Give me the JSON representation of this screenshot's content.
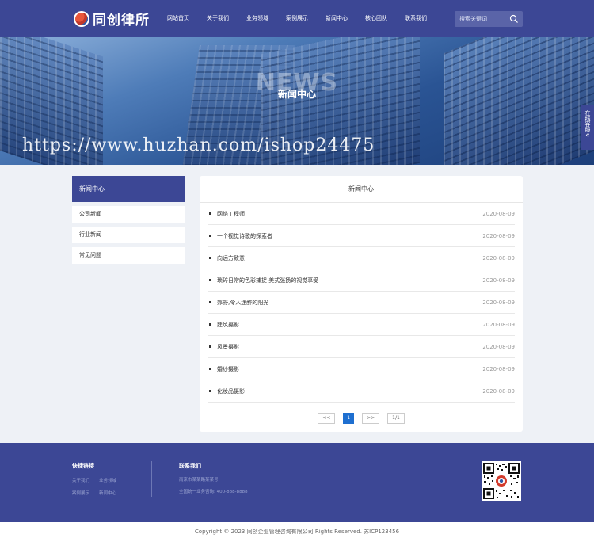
{
  "header": {
    "logo_text": "同创律所",
    "nav": [
      "网站首页",
      "关于我们",
      "业务领域",
      "案例展示",
      "新闻中心",
      "核心团队",
      "联系我们"
    ],
    "search_placeholder": "搜索关键词"
  },
  "banner": {
    "bg_title": "NEWS",
    "title": "新闻中心",
    "watermark": "https://www.huzhan.com/ishop24475"
  },
  "side_service": {
    "label": "在线客服",
    "arrow": "«"
  },
  "sidebar": {
    "title": "新闻中心",
    "items": [
      "公司新闻",
      "行业新闻",
      "常见问题"
    ]
  },
  "content": {
    "title": "新闻中心",
    "news": [
      {
        "title": "网络工程师",
        "date": "2020-08-09"
      },
      {
        "title": "一个视觉诗歌的探索者",
        "date": "2020-08-09"
      },
      {
        "title": "向远方致意",
        "date": "2020-08-09"
      },
      {
        "title": "琐碎日常的色彩捕捉 美式张扬的视觉享受",
        "date": "2020-08-09"
      },
      {
        "title": "郊野,令人迷醉的阳光",
        "date": "2020-08-09"
      },
      {
        "title": "建筑摄影",
        "date": "2020-08-09"
      },
      {
        "title": "风景摄影",
        "date": "2020-08-09"
      },
      {
        "title": "婚纱摄影",
        "date": "2020-08-09"
      },
      {
        "title": "化妆品摄影",
        "date": "2020-08-09"
      }
    ],
    "pager": {
      "prev": "<<",
      "current": "1",
      "next": ">>",
      "total": "1/1"
    }
  },
  "footer": {
    "quick_links_title": "快捷链接",
    "quick_links": [
      "关于我们",
      "业务领域",
      "案例展示",
      "新闻中心"
    ],
    "contact_title": "联系我们",
    "contact_address": "南京市某某路某某号",
    "contact_phone": "全国统一业务咨询: 400-888-8888",
    "copyright": "Copyright © 2023 同创企业管理咨询有限公司 Rights Reserved. 苏ICP123456"
  },
  "colors": {
    "primary": "#3c4795",
    "accent": "#1e6fd0"
  }
}
